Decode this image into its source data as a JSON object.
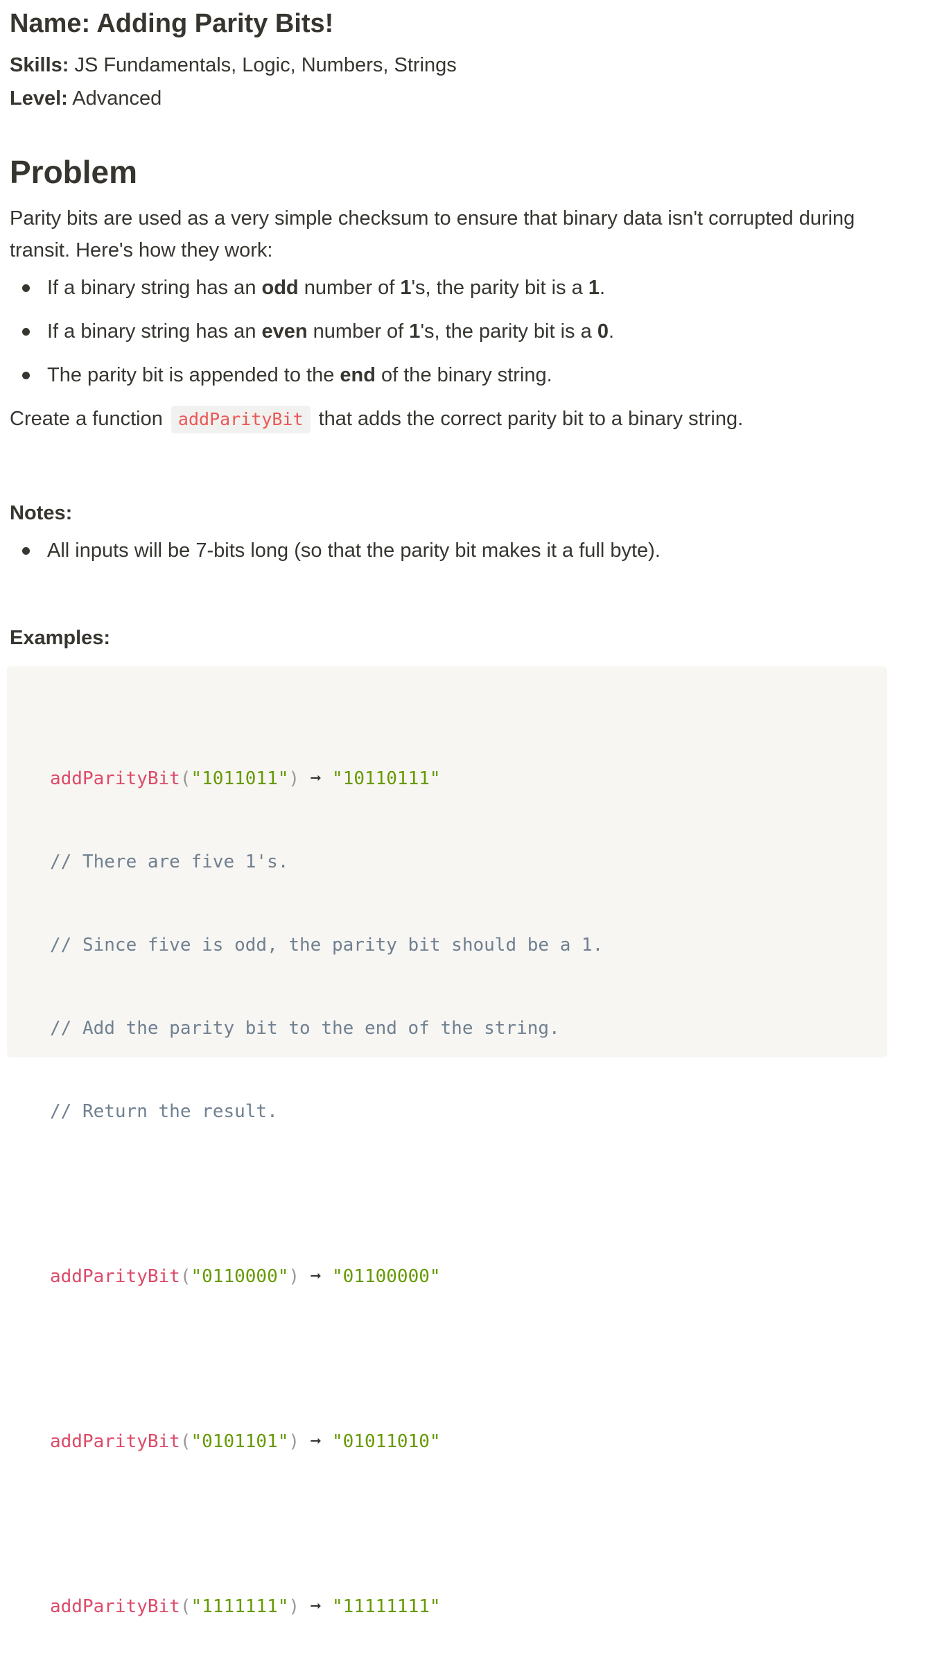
{
  "header": {
    "name_label": "Name:",
    "name_value": "Adding Parity Bits!",
    "skills_label": "Skills:",
    "skills_value": "JS Fundamentals, Logic, Numbers, Strings",
    "level_label": "Level:",
    "level_value": "Advanced"
  },
  "problem": {
    "title": "Problem",
    "intro": "Parity bits are used as a very simple checksum to ensure that binary data isn't corrupted during transit. Here's how they work:",
    "bullets": [
      {
        "pre": "If a binary string has an ",
        "bold": "odd",
        "mid": " number of ",
        "bold2": "1",
        "mid2": "'s, the parity bit is a ",
        "bold3": "1",
        "post": "."
      },
      {
        "pre": "If a binary string has an ",
        "bold": "even",
        "mid": " number of ",
        "bold2": "1",
        "mid2": "'s, the parity bit is a ",
        "bold3": "0",
        "post": "."
      },
      {
        "pre": "The parity bit is appended to the ",
        "bold": "end",
        "post": " of the binary string."
      }
    ],
    "create_pre": "Create a function",
    "create_code": "addParityBit",
    "create_post": "that adds the correct parity bit to a binary string."
  },
  "notes": {
    "label": "Notes:",
    "items": [
      "All inputs will be 7-bits long (so that the parity bit makes it a full byte)."
    ]
  },
  "examples": {
    "label": "Examples:",
    "fn": "addParityBit",
    "arrow": "➞",
    "calls": [
      {
        "input": "\"1011011\"",
        "output": "\"10110111\""
      },
      {
        "input": "\"0110000\"",
        "output": "\"01100000\""
      },
      {
        "input": "\"0101101\"",
        "output": "\"01011010\""
      },
      {
        "input": "\"1111111\"",
        "output": "\"11111111\""
      }
    ],
    "comments": [
      "// There are five 1's.",
      "// Since five is odd, the parity bit should be a 1.",
      "// Add the parity bit to the end of the string.",
      "// Return the result."
    ]
  }
}
